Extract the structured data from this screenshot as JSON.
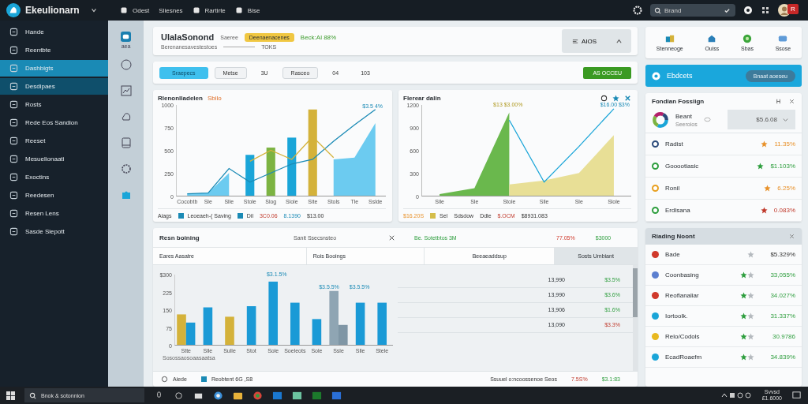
{
  "topbar": {
    "app_title": "Ekeulionarn",
    "nav": [
      {
        "label": "Odest",
        "icon": true
      },
      {
        "label": "Sliesnes",
        "icon": false
      },
      {
        "label": "Rartirte",
        "icon": true
      },
      {
        "label": "Bise",
        "icon": true
      }
    ],
    "search": {
      "placeholder": "Brand"
    },
    "notification_badge": "R"
  },
  "sidebar": {
    "items": [
      {
        "label": "Hande",
        "selected": false,
        "highlighted": false
      },
      {
        "label": "Reentbte",
        "selected": false,
        "highlighted": false
      },
      {
        "label": "Dashbigts",
        "selected": true,
        "highlighted": false
      },
      {
        "label": "Desdipaes",
        "selected": false,
        "highlighted": true
      },
      {
        "label": "Rosts",
        "selected": false,
        "highlighted": false
      },
      {
        "label": "Rede Eos Sandion",
        "selected": false,
        "highlighted": false
      },
      {
        "label": "Reeset",
        "selected": false,
        "highlighted": false
      },
      {
        "label": "Mesuelionaati",
        "selected": false,
        "highlighted": false
      },
      {
        "label": "Exoctins",
        "selected": false,
        "highlighted": false
      },
      {
        "label": "Reedesen",
        "selected": false,
        "highlighted": false
      },
      {
        "label": "Resen Lens",
        "selected": false,
        "highlighted": false
      },
      {
        "label": "Sasde Siepott",
        "selected": false,
        "highlighted": false
      }
    ]
  },
  "rail": {
    "caption": "aea"
  },
  "header": {
    "title": "UlalaSonond",
    "subtitle": "Saeree",
    "badge": "Deenaenacenes",
    "status": "Beck:Al 88%",
    "caption": "Berenanesavestestoes",
    "meta": "TOKS",
    "action": "AIOS"
  },
  "toolbar": {
    "buttons": [
      {
        "label": "Sraepecs",
        "kind": "primary"
      },
      {
        "label": "Metse",
        "kind": "outline"
      },
      {
        "label": "3U",
        "kind": "plain"
      },
      {
        "label": "Rasceo",
        "kind": "outline"
      },
      {
        "label": "04",
        "kind": "plain"
      },
      {
        "label": "103",
        "kind": "plain"
      }
    ],
    "cta": "AS OCCEU"
  },
  "charts": [
    {
      "title": "Rlenonlladelen",
      "tag": "Sbilo",
      "chart_data": {
        "type": "bar",
        "categories": [
          "Cocobtb",
          "Sle",
          "Slle",
          "Stole",
          "Slog",
          "Slole",
          "Site",
          "Stols",
          "Tle",
          "Sslde"
        ],
        "ylim": [
          0,
          1000
        ],
        "yticks": [
          0,
          250,
          500,
          750,
          1000
        ],
        "series": [
          {
            "type": "area",
            "color": "#6ccbf0",
            "values": [
              20,
              30,
              250,
              null,
              null,
              null,
              null,
              400,
              420,
              800
            ]
          },
          {
            "type": "bar",
            "color": "#1aa5d8",
            "values": [
              null,
              null,
              null,
              450,
              null,
              640,
              null,
              null,
              null,
              null
            ]
          },
          {
            "type": "bar",
            "color": "#7cb342",
            "values": [
              null,
              null,
              null,
              null,
              530,
              null,
              null,
              null,
              null,
              null
            ]
          },
          {
            "type": "bar",
            "color": "#d4b23a",
            "values": [
              null,
              null,
              null,
              null,
              null,
              null,
              950,
              null,
              null,
              null
            ]
          },
          {
            "type": "line",
            "color": "#1a8ab5",
            "values": [
              20,
              30,
              300,
              150,
              250,
              350,
              400,
              600,
              780,
              950
            ]
          },
          {
            "type": "line",
            "color": "#d4b23a",
            "values": [
              null,
              null,
              null,
              380,
              500,
              400,
              650,
              420,
              null,
              null
            ]
          }
        ],
        "annotations": [
          "$3.5 4%"
        ]
      },
      "legend": [
        {
          "text": "Aiags",
          "swatch": false,
          "kind": "plain"
        },
        {
          "text": "Leoeaeh-( Saving",
          "swatch": true,
          "kind": "plain"
        },
        {
          "text": "Dil",
          "swatch": true,
          "kind": "plain"
        },
        {
          "text": "3C0.06",
          "swatch": false,
          "kind": "negative"
        },
        {
          "text": "8.1390",
          "swatch": false,
          "kind": "info"
        },
        {
          "text": "$13.00",
          "swatch": false,
          "kind": "plain"
        }
      ]
    },
    {
      "title": "Flerear dalin",
      "chart_data": {
        "type": "area",
        "categories": [
          "Slle",
          "Sle",
          "Stole",
          "Slle",
          "Sle",
          "Slole"
        ],
        "ylim": [
          0,
          1200
        ],
        "yticks": [
          0,
          300,
          600,
          900,
          1200
        ],
        "series": [
          {
            "type": "area",
            "color": "#6ab84d",
            "values": [
              20,
              100,
              1100,
              null,
              null,
              null
            ]
          },
          {
            "type": "area",
            "color": "#e8df96",
            "values": [
              null,
              null,
              150,
              200,
              300,
              800
            ]
          },
          {
            "type": "line",
            "color": "#1aa5d8",
            "values": [
              null,
              null,
              1000,
              180,
              650,
              1150
            ]
          }
        ],
        "annotations": [
          "$13 $3.00%",
          "$16.00 $3%"
        ]
      },
      "legend": [
        {
          "text": "$16.20S",
          "swatch": false,
          "kind": "warning"
        },
        {
          "text": "Sel",
          "swatch": true,
          "kind": "plain"
        },
        {
          "text": "Sdsdow",
          "swatch": false,
          "kind": "plain"
        },
        {
          "text": "Ddle",
          "swatch": false,
          "kind": "plain"
        },
        {
          "text": "$.OCM",
          "swatch": false,
          "kind": "negative"
        },
        {
          "text": "$8931.083",
          "swatch": false,
          "kind": "plain"
        }
      ]
    }
  ],
  "bottom": {
    "title": "Resn boining",
    "subtitle": "Sanit Ssecsnsteo",
    "status": "Be. Sotetbtos 3M",
    "loss": "77.05%",
    "amount": "$3000",
    "columns": [
      "Eares Aasatre",
      "Rois Booings",
      "Beeaeaddsup",
      "Sosts Umbiant"
    ],
    "chart_data": {
      "type": "bar",
      "categories": [
        "Stte",
        "Slle",
        "Sulle",
        "Stot",
        "Sole",
        "Soeleots",
        "Sole",
        "Ssle",
        "Slle",
        "Stele"
      ],
      "ylim": [
        0,
        300
      ],
      "yticks": [
        0,
        75,
        150,
        225,
        {
          "value": 300,
          "label": "$300"
        }
      ],
      "series": [
        {
          "type": "bar",
          "color": "#d4b23a",
          "values": [
            130,
            null,
            120,
            null,
            null,
            null,
            null,
            null,
            null,
            null
          ]
        },
        {
          "type": "bar",
          "color": "#1a9ad6",
          "values": [
            95,
            160,
            null,
            165,
            270,
            180,
            110,
            null,
            180,
            180
          ]
        },
        {
          "type": "bar",
          "color": "#8fa5b3",
          "values": [
            null,
            null,
            null,
            null,
            null,
            null,
            null,
            230,
            null,
            null
          ]
        },
        {
          "type": "bar",
          "color": "#7f96a5",
          "values": [
            null,
            null,
            null,
            null,
            null,
            null,
            null,
            85,
            null,
            null
          ]
        }
      ],
      "annotations": [
        "$3.1.5%",
        "$3.5.5%",
        "$3.5.5%"
      ]
    },
    "x_caption": "Sosossaosoaasaatsa",
    "rows": [
      {
        "value": "13,990",
        "change": "$3.5%",
        "kind": "positive"
      },
      {
        "value": "13,990",
        "change": "$3.6%",
        "kind": "positive"
      },
      {
        "value": "13,906",
        "change": "$1.6%",
        "kind": "positive"
      },
      {
        "value": "13,090",
        "change": "$3.3%",
        "kind": "negative"
      }
    ],
    "footer": [
      {
        "text": "Aiede",
        "kind": "plain"
      },
      {
        "text": "Reobtent 6G ,S8",
        "kind": "plain"
      },
      {
        "text": "Ssuuel o:ncoossenoe Seos",
        "kind": "plain"
      },
      {
        "text": "7.5S%",
        "kind": "negative"
      },
      {
        "text": "$3.1:83",
        "kind": "positive"
      }
    ]
  },
  "tiles": [
    {
      "label": "Stenneoge"
    },
    {
      "label": "Ouiss"
    },
    {
      "label": "Sbas"
    },
    {
      "label": "Ssose"
    }
  ],
  "banner": {
    "title": "Ebdcets",
    "button": "Bnaat aoeseu"
  },
  "forecast": {
    "title": "Fondian Fossiign",
    "donut_title": "Beant",
    "donut_caption": "Seeroios",
    "select": "$5.6.08",
    "rows": [
      {
        "label": "Radist",
        "color": "#2b4a7a",
        "value": "11.35%",
        "kind": "warning"
      },
      {
        "label": "Gooootiasic",
        "color": "#2e9e3e",
        "value": "$1.103%",
        "kind": "positive"
      },
      {
        "label": "Ronil",
        "color": "#e8a020",
        "value": "6.25%",
        "kind": "warning"
      },
      {
        "label": "Erdlsana",
        "color": "#2e9e3e",
        "value": "0.083%",
        "kind": "negative"
      }
    ]
  },
  "reading": {
    "title": "Riading Noont",
    "rows": [
      {
        "label": "Bade",
        "color": "#d0392b",
        "kind": "plain",
        "value": "$5.329%"
      },
      {
        "label": "Coonbasing",
        "color": "#5b7fd0",
        "kind": "positive",
        "value": "33,055%"
      },
      {
        "label": "Reoflanaliar",
        "color": "#d0392b",
        "kind": "positive",
        "value": "34.027%"
      },
      {
        "label": "Iortoolk.",
        "color": "#1aa5d8",
        "kind": "positive",
        "value": "31.337%"
      },
      {
        "label": "Relo/Codols",
        "color": "#e8b820",
        "kind": "positive",
        "value": "30.9786"
      },
      {
        "label": "EcadRoaefm",
        "color": "#1aa5d8",
        "kind": "positive",
        "value": "34.839%"
      }
    ]
  },
  "taskbar": {
    "search": "Bnok & sotonnion",
    "clock_time": "Svvsd",
    "clock_date": "£1.6000"
  }
}
